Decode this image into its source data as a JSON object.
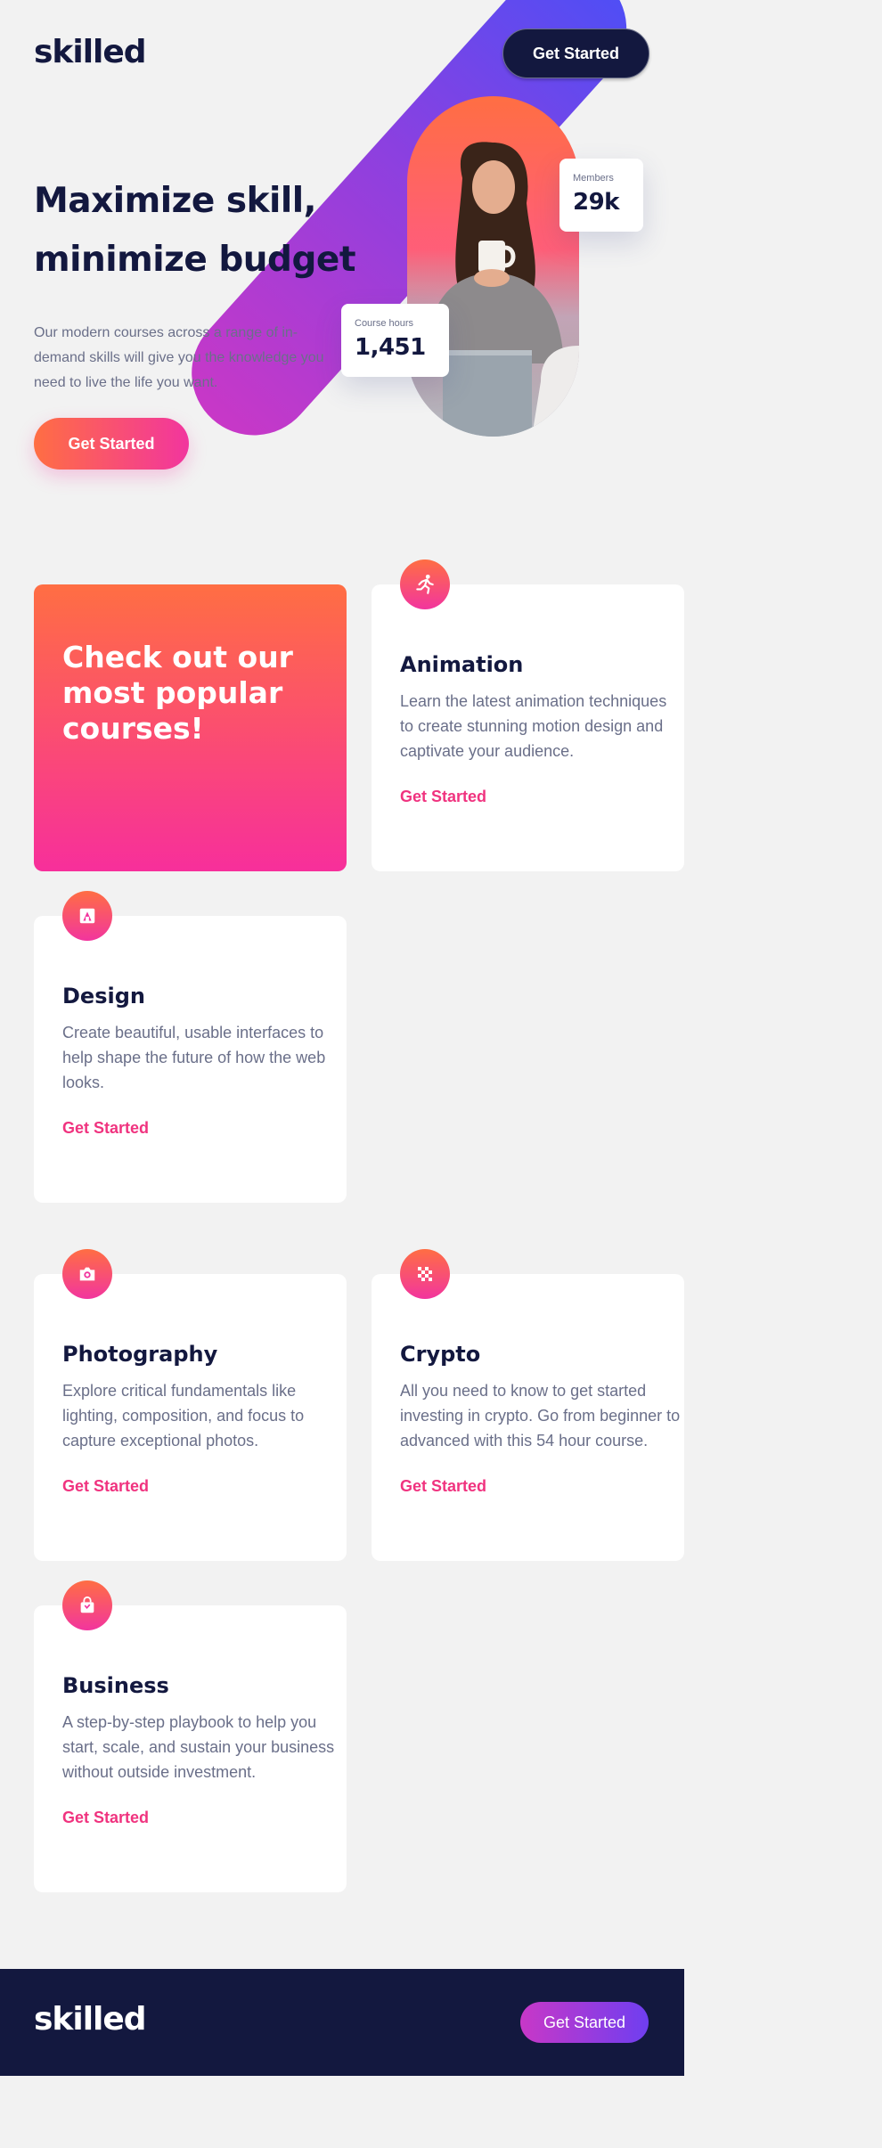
{
  "header": {
    "logo": "skilled",
    "cta_label": "Get Started"
  },
  "hero": {
    "title_line1": "Maximize skill,",
    "title_line2": "minimize budget",
    "description_line1": "Our modern courses across a range of in-",
    "description_line2": "demand skills will give you the knowledge you",
    "description_line3": "need to live the life you want.",
    "cta_label": "Get Started",
    "stats": {
      "members_label": "Members",
      "members_value": "29k",
      "hours_label": "Course hours",
      "hours_value": "1,451"
    }
  },
  "promo": {
    "line1": "Check out our",
    "line2": "most popular",
    "line3": "courses!"
  },
  "courses": [
    {
      "icon": "running-figure-icon",
      "title": "Animation",
      "line1": "Learn the latest animation techniques",
      "line2": "to create stunning motion design and",
      "line3": "captivate your audience.",
      "link": "Get Started"
    },
    {
      "icon": "design-tool-icon",
      "title": "Design",
      "line1": "Create beautiful, usable interfaces to",
      "line2": "help shape the future of how the web",
      "line3": "looks.",
      "link": "Get Started"
    },
    {
      "icon": "camera-icon",
      "title": "Photography",
      "line1": "Explore critical fundamentals like",
      "line2": "lighting, composition, and focus to",
      "line3": "capture exceptional photos.",
      "link": "Get Started"
    },
    {
      "icon": "crypto-pixel-icon",
      "title": "Crypto",
      "line1": "All you need to know to get started",
      "line2": "investing in crypto. Go from beginner to",
      "line3": "advanced with this 54 hour course.",
      "link": "Get Started"
    },
    {
      "icon": "shopping-bag-icon",
      "title": "Business",
      "line1": "A step-by-step playbook to help you",
      "line2": "start, scale, and sustain your business",
      "line3": "without outside investment.",
      "link": "Get Started"
    }
  ],
  "footer": {
    "logo": "skilled",
    "cta_label": "Get Started"
  },
  "colors": {
    "navy": "#13183f",
    "orange": "#ff6e43",
    "pink": "#f2359e",
    "blue": "#4f4ef5",
    "gray_text": "#6a6f89",
    "background": "#f2f2f2"
  }
}
